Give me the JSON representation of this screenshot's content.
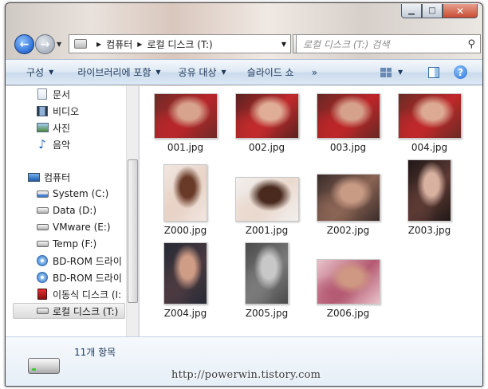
{
  "address": {
    "crumbs": [
      "컴퓨터",
      "로컬 디스크 (T:)"
    ]
  },
  "search": {
    "placeholder": "로컬 디스크 (T:) 검색"
  },
  "toolbar": {
    "organize": "구성",
    "include_library": "라이브러리에 포함",
    "share_with": "공유 대상",
    "slideshow": "슬라이드 쇼",
    "more": "»"
  },
  "nav": {
    "libraries": [
      {
        "label": "문서",
        "icon": "document-icon"
      },
      {
        "label": "비디오",
        "icon": "video-icon"
      },
      {
        "label": "사진",
        "icon": "picture-icon"
      },
      {
        "label": "음악",
        "icon": "music-icon"
      }
    ],
    "computer": "컴퓨터",
    "drives": [
      {
        "label": "System (C:)",
        "icon": "system-drive-icon"
      },
      {
        "label": "Data (D:)",
        "icon": "drive-icon"
      },
      {
        "label": "VMware (E:)",
        "icon": "drive-icon"
      },
      {
        "label": "Temp (F:)",
        "icon": "drive-icon"
      },
      {
        "label": "BD-ROM 드라이",
        "icon": "optical-drive-icon"
      },
      {
        "label": "BD-ROM 드라이",
        "icon": "optical-drive-icon"
      },
      {
        "label": "이동식 디스크 (I:",
        "icon": "removable-drive-icon"
      },
      {
        "label": "로컬 디스크 (T:)",
        "icon": "drive-icon"
      }
    ]
  },
  "files": [
    {
      "name": "001.jpg",
      "palette": [
        "#6e2a26",
        "#d8a38c",
        "#b8262a"
      ]
    },
    {
      "name": "002.jpg",
      "palette": [
        "#5a2220",
        "#e0ad96",
        "#c22a2c"
      ]
    },
    {
      "name": "003.jpg",
      "palette": [
        "#662823",
        "#d6a18b",
        "#be2629"
      ]
    },
    {
      "name": "004.jpg",
      "palette": [
        "#6a2a24",
        "#dcaa92",
        "#c0282b"
      ]
    },
    {
      "name": "Z000.jpg",
      "palette": [
        "#f1e7e1",
        "#6a3a28",
        "#e8d3c6"
      ]
    },
    {
      "name": "Z001.jpg",
      "palette": [
        "#f2f0ee",
        "#4a2a1e",
        "#ead9ce"
      ]
    },
    {
      "name": "Z002.jpg",
      "palette": [
        "#3a2c2a",
        "#c89b84",
        "#8a6454"
      ]
    },
    {
      "name": "Z003.jpg",
      "palette": [
        "#1f1716",
        "#d9b1a0",
        "#5c3a34"
      ]
    },
    {
      "name": "Z004.jpg",
      "palette": [
        "#262a35",
        "#cf9c86",
        "#4a3a40"
      ]
    },
    {
      "name": "Z005.jpg",
      "palette": [
        "#4a4a4a",
        "#c8c8c8",
        "#7a7a7a"
      ]
    },
    {
      "name": "Z006.jpg",
      "palette": [
        "#e9c3c9",
        "#cf9882",
        "#b45a72"
      ]
    }
  ],
  "status": {
    "count": "11개 항목"
  },
  "watermark": "http://powerwin.tistory.com"
}
